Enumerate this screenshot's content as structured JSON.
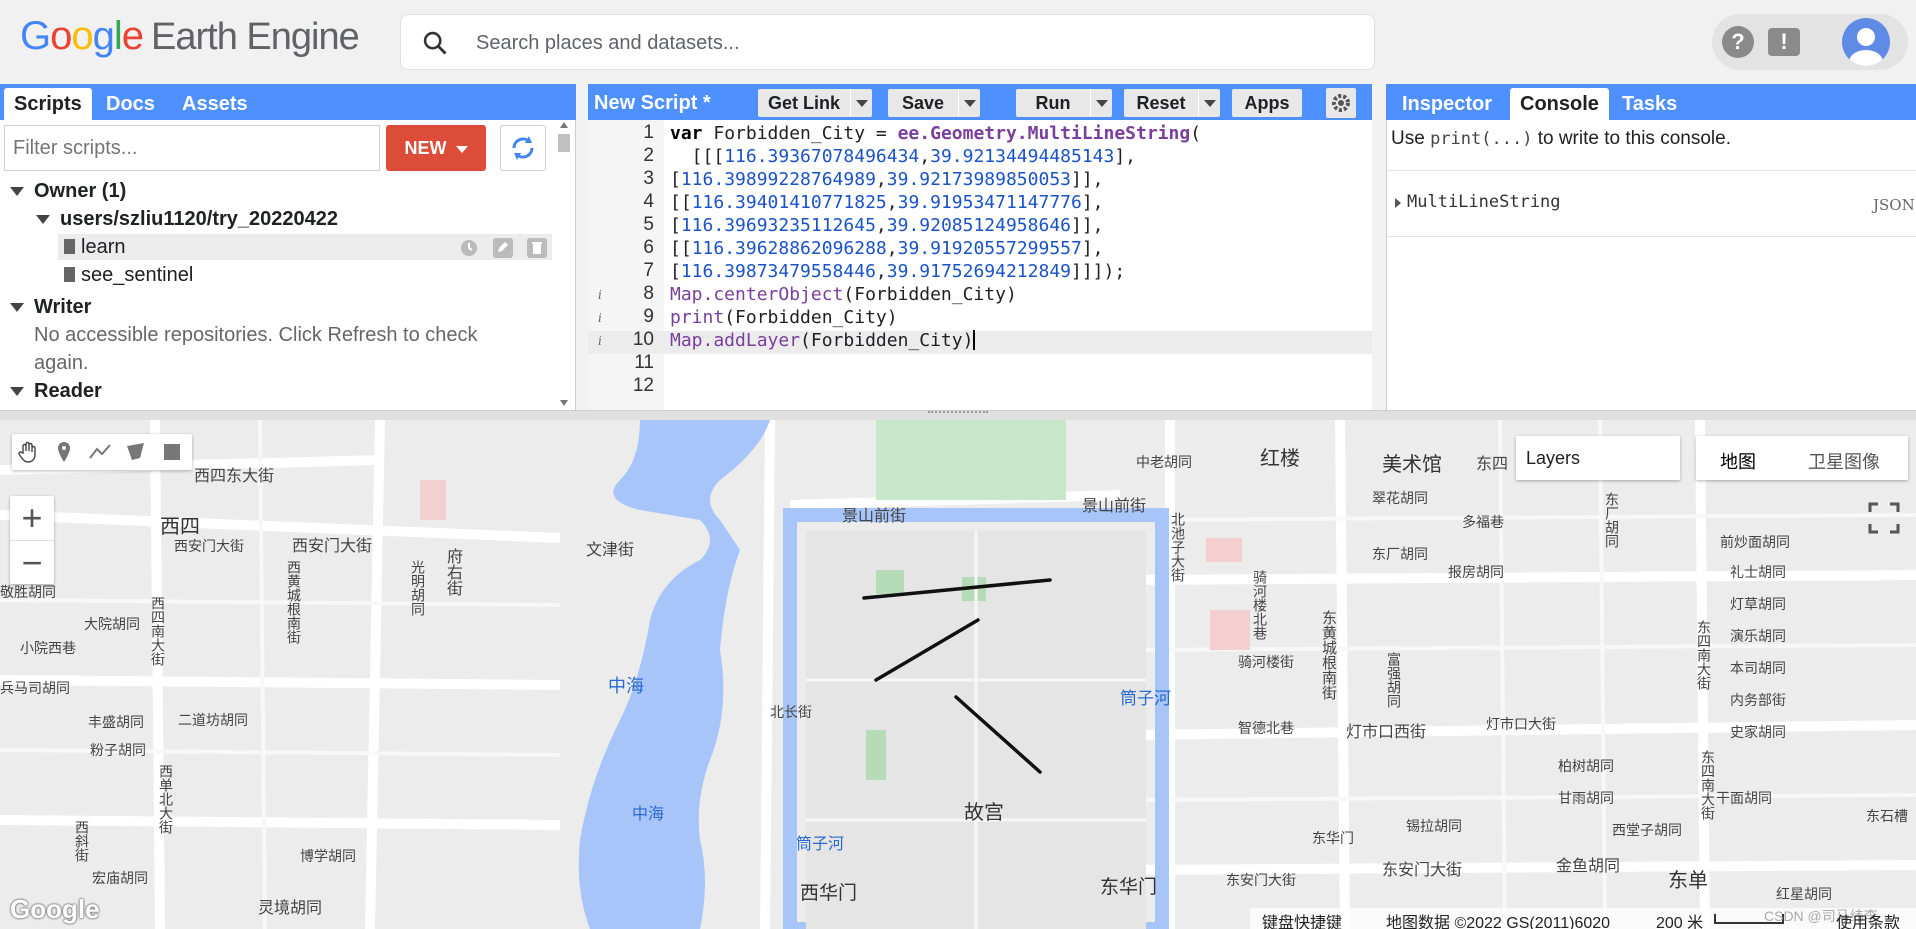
{
  "header": {
    "logo_letters": [
      "G",
      "o",
      "o",
      "g",
      "l",
      "e"
    ],
    "product": "Earth Engine",
    "search_placeholder": "Search places and datasets..."
  },
  "left_panel": {
    "tabs": [
      "Scripts",
      "Docs",
      "Assets"
    ],
    "filter_placeholder": "Filter scripts...",
    "new_label": "NEW",
    "tree": {
      "owner": "Owner (1)",
      "repo": "users/szliu1120/try_20220422",
      "files": [
        "learn",
        "see_sentinel"
      ],
      "writer": "Writer",
      "writer_msg_1": "No accessible repositories. Click Refresh to check",
      "writer_msg_2": "again.",
      "reader": "Reader"
    }
  },
  "editor": {
    "title": "New Script *",
    "buttons": [
      "Get Link",
      "Save",
      "Run",
      "Reset",
      "Apps"
    ],
    "line_numbers": [
      "1",
      "2",
      "3",
      "4",
      "5",
      "6",
      "7",
      "8",
      "9",
      "10",
      "11",
      "12"
    ],
    "lines": {
      "l1_kw": "var",
      "l1_name": " Forbidden_City = ",
      "l1_fn": "ee.Geometry.MultiLineString",
      "l1_paren": "(",
      "l2_open": "  [[[",
      "l2_a": "116.39367078496434",
      "l2_b": "39.92134494485143",
      "l2_close": "],",
      "l3_open": "[",
      "l3_a": "116.39899228764989",
      "l3_b": "39.92173989850053",
      "l3_close": "]],",
      "l4_open": "[[",
      "l4_a": "116.39401410771825",
      "l4_b": "39.91953471147776",
      "l4_close": "],",
      "l5_open": "[",
      "l5_a": "116.39693235112645",
      "l5_b": "39.92085124958646",
      "l5_close": "]],",
      "l6_open": "[[",
      "l6_a": "116.39628862096288",
      "l6_b": "39.91920557299557",
      "l6_close": "],",
      "l7_open": "[",
      "l7_a": "116.39873479558446",
      "l7_b": "39.91752694212849",
      "l7_close": "]]]);",
      "l8_fn": "Map.centerObject",
      "l8_arg": "(Forbidden_City)",
      "l9_fn": "print",
      "l9_arg": "(Forbidden_City)",
      "l10_fn": "Map.addLayer",
      "l10_arg": "(Forbidden_City)",
      "comma": ","
    }
  },
  "right_panel": {
    "tabs": [
      "Inspector",
      "Console",
      "Tasks"
    ],
    "hint_pre": "Use ",
    "hint_code": "print(...)",
    "hint_post": " to write to this console.",
    "output_item": "MultiLineString",
    "output_json": "JSON"
  },
  "map": {
    "layers_label": "Layers",
    "map_types": [
      "地图",
      "卫星图像"
    ],
    "labels": {
      "xisi_dongjie": "西四东大街",
      "xisi": "西四",
      "xianmen": "西安门大街",
      "xianmen2": "西安门大街",
      "wenjin": "文津街",
      "jingshan_w": "景山前街",
      "jingshan_e": "景山前街",
      "zhonglao": "中老胡同",
      "honglou": "红楼",
      "meishu": "美术馆",
      "dong": "东四",
      "cuihua": "翠花胡同",
      "duofu": "多福巷",
      "dongchang": "东厂胡同",
      "baofang": "报房胡同",
      "qianchao": "前炒面胡同",
      "lishi": "礼士胡同",
      "dengcao": "灯草胡同",
      "yanle": "演乐胡同",
      "benshi": "本司胡同",
      "neiwu": "内务部街",
      "shijia": "史家胡同",
      "zhonghai": "中海",
      "zhonghai2": "中海",
      "tongzi_e": "筒子河",
      "tongzi_w": "筒子河",
      "beichang": "北长街",
      "zhineng": "智德北巷",
      "dengshi": "灯市口西街",
      "dengshi2": "灯市口大街",
      "bailin": "柏树胡同",
      "ganyu": "甘雨胡同",
      "xitang": "西堂子胡同",
      "qianmian": "干面胡同",
      "gugong": "故宫",
      "xihua": "西华门",
      "donghua": "东华门",
      "dongan": "东安门大街",
      "dongan2": "东安门大街",
      "jinyu": "金鱼胡同",
      "dongdan": "东单",
      "hongxing": "红星胡同",
      "xidan_n": "西单北大街",
      "boxue": "博学胡同",
      "lingjing": "灵境胡同",
      "hongyan": "宏庙胡同",
      "fenzi": "粉子胡同",
      "fengsheng": "丰盛胡同",
      "ersan": "二道坊胡同",
      "dayuan": "大院胡同",
      "xiaoyu": "小院西巷",
      "bing": "兵马司胡同",
      "jingsheng": "敬胜胡同",
      "xisi_s": "西四南大街",
      "xihuang": "西黄城根南街",
      "guangming": "光明胡同",
      "fuyou": "府右街",
      "beichizi": "北池子大街",
      "qihe": "骑河楼北巷",
      "qihe2": "骑河楼街",
      "donghuang": "东黄城根南街",
      "fuqiang": "富强胡同",
      "dongsi_s": "东四南大街",
      "dongsi_s2": "东四南大街",
      "dongcheng": "东华门",
      "xishi": "锡拉胡同",
      "dongchang2": "东厂胡同",
      "xizhi": "西斜街",
      "dong2": "东石槽"
    },
    "footer": {
      "shortcuts": "键盘快捷键",
      "data": "地图数据 ©2022 GS(2011)6020",
      "scale": "200 米",
      "terms": "使用条款",
      "watermark": "CSDN @司马纬李"
    },
    "google": "Google"
  },
  "colors": {
    "panel_bar": "#4d90fe",
    "new_button": "#dd4b39",
    "water": "#aac7f7",
    "road": "#ffffff"
  }
}
